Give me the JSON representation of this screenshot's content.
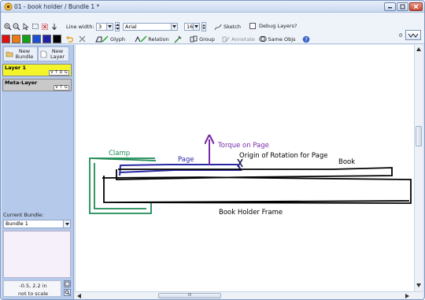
{
  "window": {
    "title": "01 - book holder / Bundle 1 *"
  },
  "toolbar": {
    "line_width_label": "Line width:",
    "line_width_value": "3",
    "font_name": "Arial",
    "font_size": "16",
    "sketch_label": "Sketch",
    "debug_layers_label": "Debug Layers?",
    "glyph_label": "Glyph",
    "relation_label": "Relation",
    "group_label": "Group",
    "annotate_label": "Annotate",
    "same_objs_label": "Same Objs",
    "zero_label": "0",
    "colors": [
      "#e01010",
      "#f07a10",
      "#15a015",
      "#1a4fd8",
      "#2020a8",
      "#000000"
    ]
  },
  "sidebar": {
    "new_bundle_label": "New\nBundle",
    "new_layer_label": "New\nLayer",
    "layers": [
      {
        "name": "Layer 1",
        "flags": [
          "V",
          "T",
          "D",
          "G"
        ],
        "active": true
      },
      {
        "name": "Meta-Layer",
        "flags": [
          "V",
          "T",
          "G"
        ],
        "active": false
      }
    ],
    "current_bundle_label": "Current Bundle:",
    "current_bundle_value": "Bundle 1",
    "coords": "-0.5, 2.2 in",
    "scale_note": "not to scale"
  },
  "sketch": {
    "labels": {
      "clamp": "Clamp",
      "page": "Page",
      "torque": "Torque on Page",
      "origin": "Origin of Rotation for Page",
      "book": "Book",
      "frame": "Book Holder Frame"
    },
    "colors": {
      "clamp": "#1f8a55",
      "page": "#2a2aa8",
      "torque": "#7a2aa8",
      "book": "#000000"
    }
  },
  "scrollbar": {
    "thumb_grip": "III"
  }
}
